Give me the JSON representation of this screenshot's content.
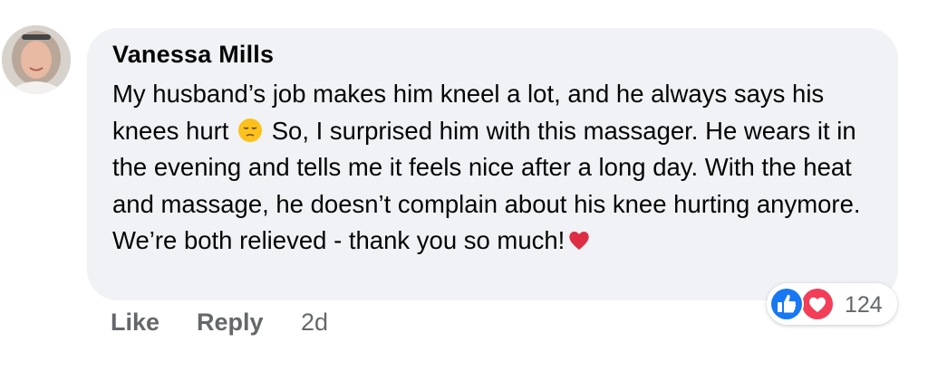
{
  "comment": {
    "author": "Vanessa Mills",
    "text_part1": "My husband’s job makes him kneel a lot, and he always says his knees hurt",
    "text_part2": "So, I surprised him with this massager. He wears it in the evening and tells me it feels nice after a long day. With the heat and massage, he doesn’t complain about his knee hurting anymore. We’re both relieved - thank you so much!",
    "emoji_after_part1": "pensive-face-icon",
    "emoji_after_part2": "red-heart-icon"
  },
  "reactions": {
    "types": [
      "like-reaction-icon",
      "love-reaction-icon"
    ],
    "count": "124",
    "like_color": "#1877f2",
    "love_color": "#f33e58"
  },
  "actions": {
    "like_label": "Like",
    "reply_label": "Reply",
    "timestamp": "2d"
  },
  "colors": {
    "bubble_bg": "#f0f2f5",
    "text": "#050505",
    "secondary_text": "#65676b"
  }
}
